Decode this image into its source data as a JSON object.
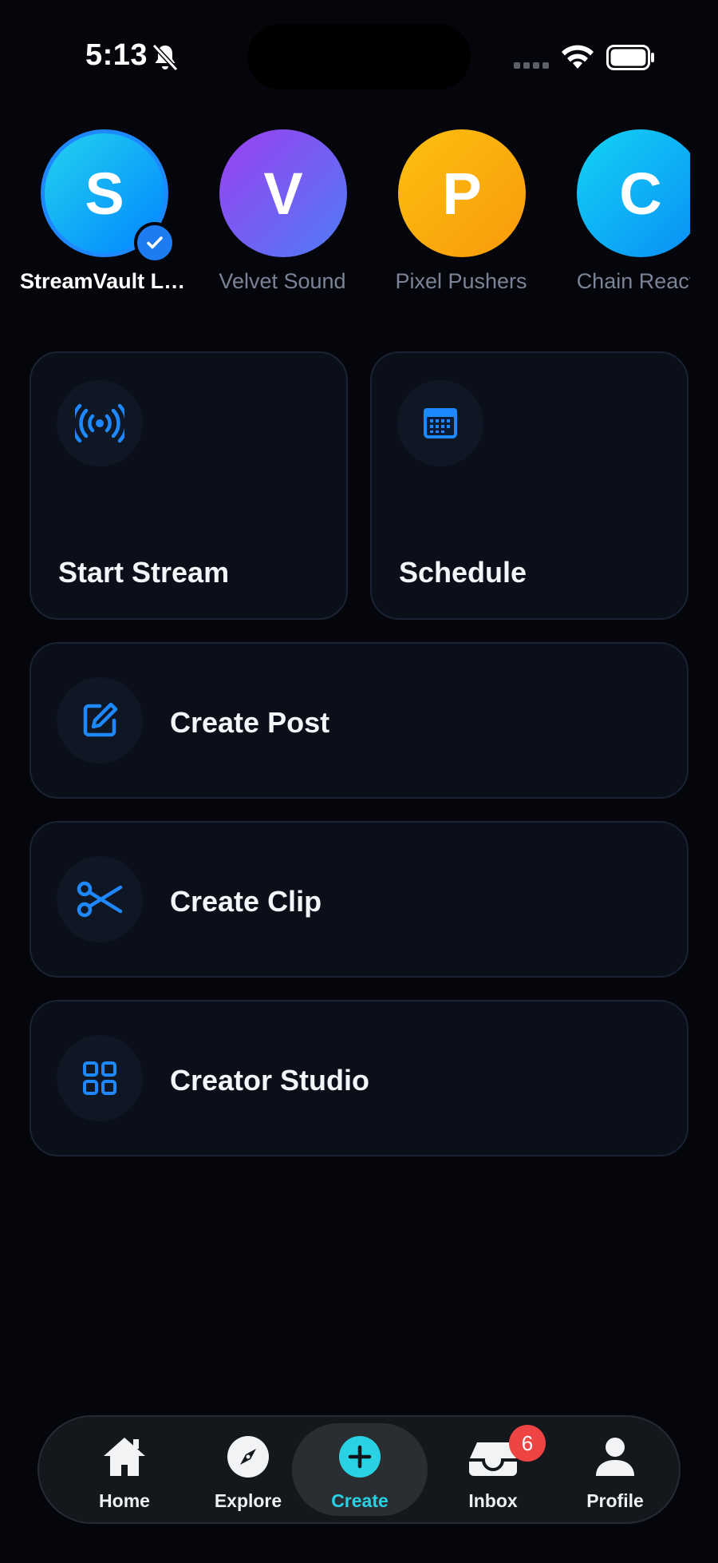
{
  "status_bar": {
    "time": "5:13"
  },
  "accounts": [
    {
      "initial": "S",
      "name": "StreamVault Live",
      "selected": true,
      "gradient": [
        "#22d3ee",
        "#0284ff"
      ]
    },
    {
      "initial": "V",
      "name": "Velvet Sound",
      "selected": false,
      "gradient": [
        "#9b3ff0",
        "#4f7cf6"
      ]
    },
    {
      "initial": "P",
      "name": "Pixel Pushers",
      "selected": false,
      "gradient": [
        "#fcc010",
        "#f99a0a"
      ]
    },
    {
      "initial": "C",
      "name": "Chain Reaction",
      "selected": false,
      "gradient": [
        "#12d4f5",
        "#0a8cf5"
      ]
    }
  ],
  "actions": {
    "start_stream": "Start Stream",
    "schedule": "Schedule",
    "create_post": "Create Post",
    "create_clip": "Create Clip",
    "creator_studio": "Creator Studio"
  },
  "tab_bar": {
    "home": "Home",
    "explore": "Explore",
    "create": "Create",
    "inbox": "Inbox",
    "inbox_badge": "6",
    "profile": "Profile"
  },
  "colors": {
    "accent": "#1e88ff",
    "create_active": "#28d2e4",
    "badge": "#ef4444"
  }
}
